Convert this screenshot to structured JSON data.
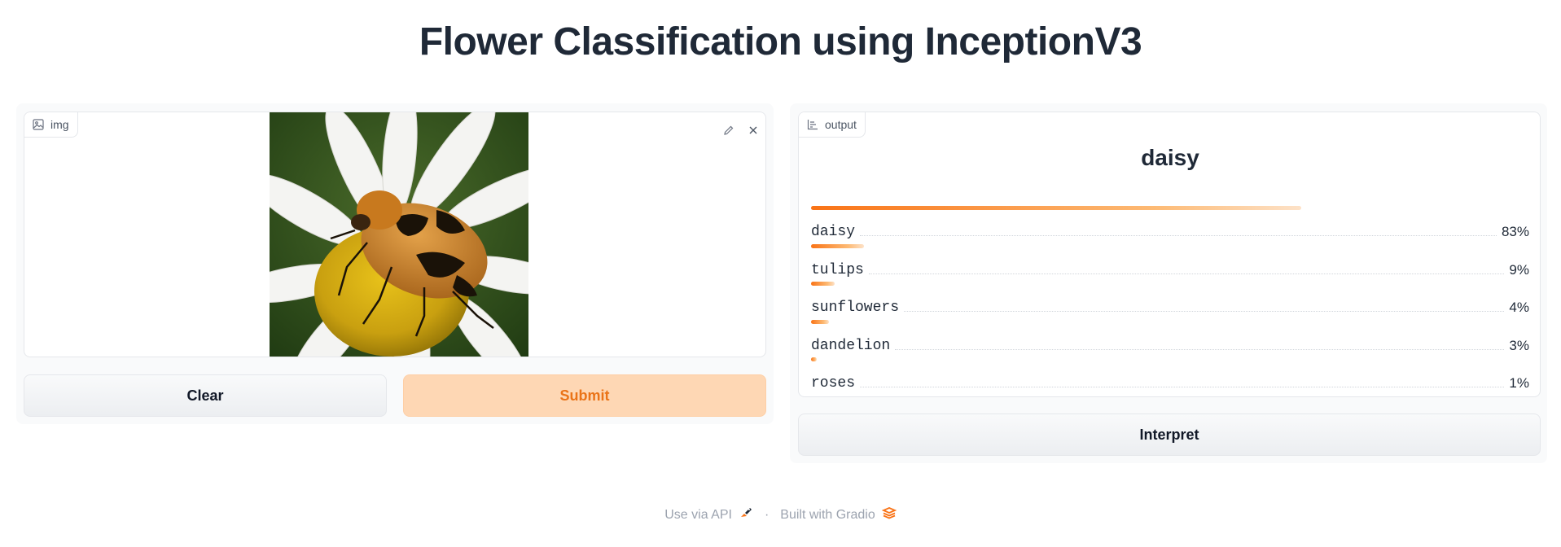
{
  "page": {
    "title": "Flower Classification using InceptionV3"
  },
  "input": {
    "label": "img",
    "clear_label": "Clear",
    "submit_label": "Submit"
  },
  "output": {
    "label": "output",
    "top_prediction": "daisy",
    "predictions": [
      {
        "label": "daisy",
        "value_text": "83%",
        "fraction": 0.83
      },
      {
        "label": "tulips",
        "value_text": "9%",
        "fraction": 0.09
      },
      {
        "label": "sunflowers",
        "value_text": "4%",
        "fraction": 0.04
      },
      {
        "label": "dandelion",
        "value_text": "3%",
        "fraction": 0.03
      },
      {
        "label": "roses",
        "value_text": "1%",
        "fraction": 0.01
      }
    ],
    "interpret_label": "Interpret"
  },
  "footer": {
    "api_label": "Use via API",
    "separator": "·",
    "built_label": "Built with Gradio"
  },
  "colors": {
    "accent": "#f97316",
    "submit_bg": "#fed7b4",
    "submit_text": "#ea7317"
  }
}
